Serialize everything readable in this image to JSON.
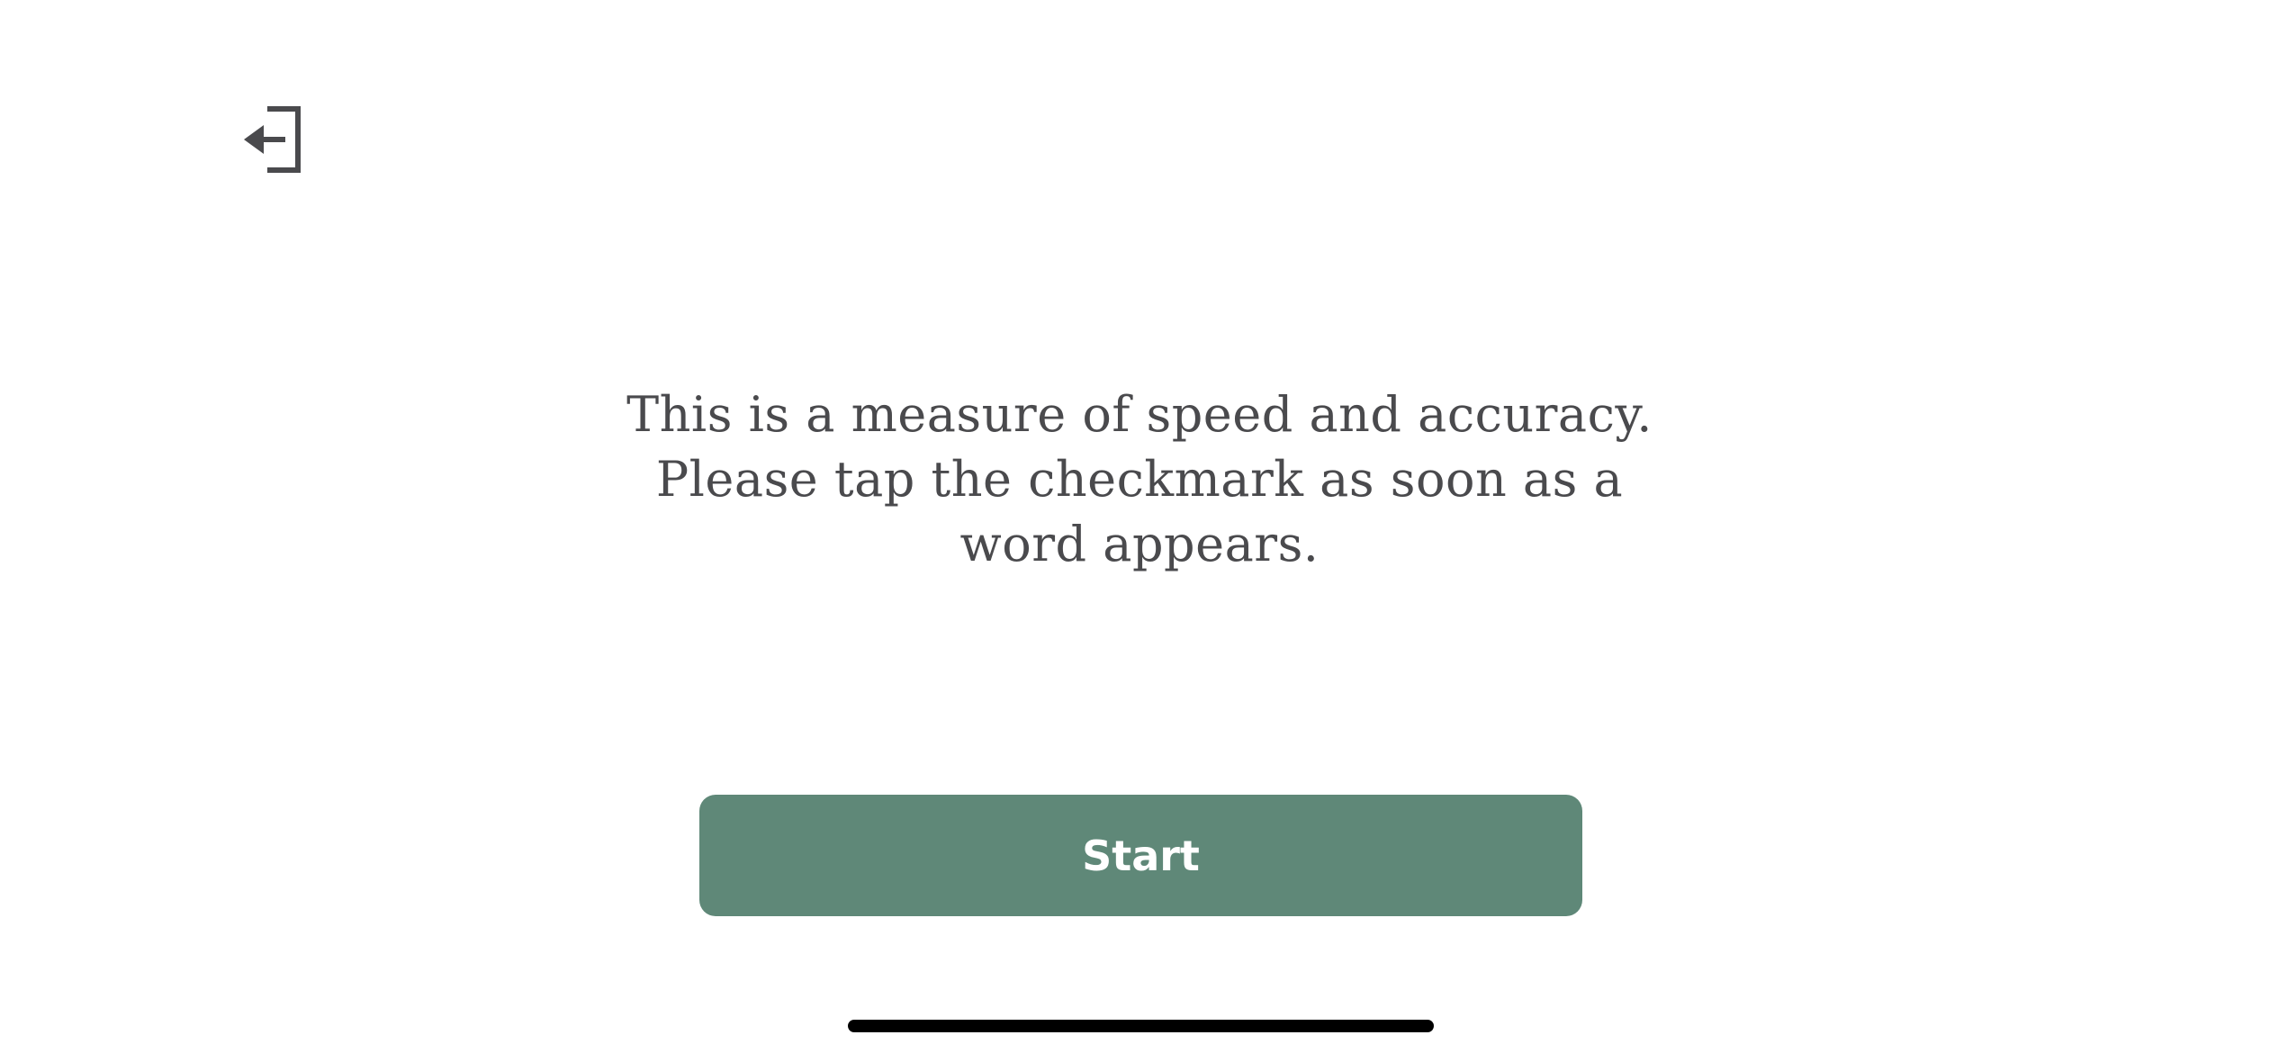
{
  "header": {
    "exit_icon": "exit-to-left-icon"
  },
  "main": {
    "instructions": "This is a measure of speed and accuracy. Please tap the checkmark as soon as a word appears.",
    "start_label": "Start"
  },
  "colors": {
    "background": "#ffffff",
    "text": "#4a4a4d",
    "button": "#5f8878",
    "button_text": "#ffffff",
    "icon": "#4a4a4d"
  }
}
